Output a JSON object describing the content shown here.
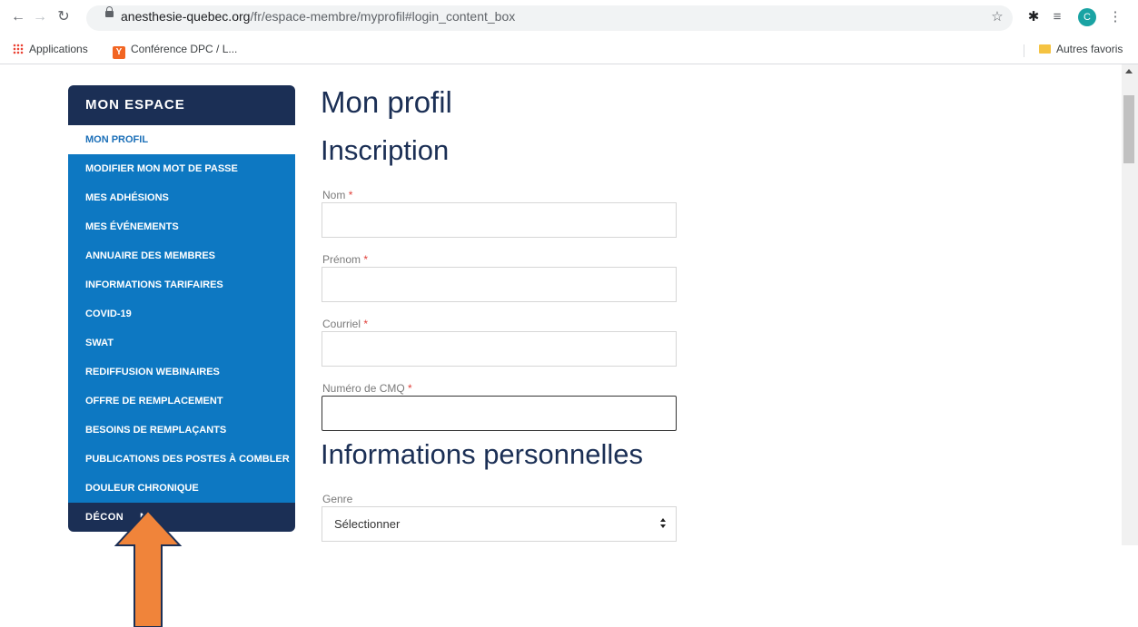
{
  "browser": {
    "url_host": "anesthesie-quebec.org",
    "url_path": "/fr/espace-membre/myprofil#login_content_box",
    "avatar_letter": "C",
    "icons": [
      "back-icon",
      "forward-icon",
      "reload-icon",
      "lock-icon",
      "star-icon",
      "extensions-icon",
      "media-icon",
      "menu-icon"
    ]
  },
  "bookmarks": {
    "items": [
      {
        "label": "Applications",
        "icon": "apps-grid-icon"
      },
      {
        "label": "Conférence DPC / L...",
        "icon": "yc-favicon-icon"
      }
    ],
    "other": "Autres favoris"
  },
  "sidebar": {
    "heading": "MON ESPACE",
    "active": "MON PROFIL",
    "items": [
      "MODIFIER MON MOT DE PASSE",
      "MES ADHÉSIONS",
      "MES ÉVÉNEMENTS",
      "ANNUAIRE DES MEMBRES",
      "INFORMATIONS TARIFAIRES",
      "COVID-19",
      "SWAT",
      "REDIFFUSION WEBINAIRES",
      "OFFRE DE REMPLACEMENT",
      "BESOINS DE REMPLAÇANTS",
      "PUBLICATIONS DES POSTES À COMBLER",
      "DOULEUR CHRONIQUE"
    ],
    "logout": "DÉCON     N"
  },
  "main": {
    "title": "Mon profil",
    "section1": "Inscription",
    "fields": [
      {
        "label": "Nom",
        "required": "*",
        "value": ""
      },
      {
        "label": "Prénom",
        "required": "*",
        "value": ""
      },
      {
        "label": "Courriel",
        "required": "*",
        "value": ""
      },
      {
        "label": "Numéro de CMQ",
        "required": "*",
        "value": ""
      }
    ],
    "section2": "Informations personnelles",
    "genre_label": "Genre",
    "genre_value": "Sélectionner"
  },
  "colors": {
    "navy": "#1b2f55",
    "blue": "#0d78c2",
    "active_text": "#1b6fb8",
    "arrow": "#f0843a"
  }
}
